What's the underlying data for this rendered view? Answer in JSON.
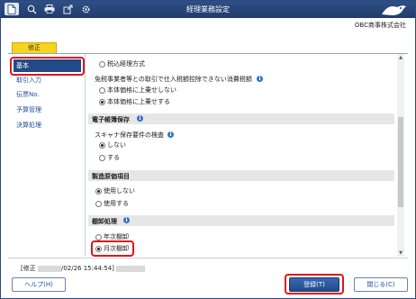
{
  "window": {
    "title": "経理業務設定",
    "company": "OBC商事株式会社"
  },
  "toolbar": {
    "icons": [
      "document-icon",
      "search-icon",
      "print-icon",
      "export-icon",
      "settings-icon"
    ]
  },
  "mode_badge": "修正",
  "sidebar": {
    "items": [
      {
        "label": "基本",
        "selected": true
      },
      {
        "label": "取引入力"
      },
      {
        "label": "伝票No."
      },
      {
        "label": "予算管理"
      },
      {
        "label": "決算処理"
      }
    ]
  },
  "content": {
    "top_option": "税込経理方式",
    "tax_question": "免税事業者等との取引で仕入税額控除できない消費税額",
    "tax_options": [
      "本体価格に上乗せしない",
      "本体価格に上乗せする"
    ],
    "tax_selected": 1,
    "section_denshi": "電子帳簿保存",
    "scanner_question": "スキャナ保存要件の検査",
    "scanner_options": [
      "しない",
      "する"
    ],
    "scanner_selected": 0,
    "section_cost": "製造原価項目",
    "cost_options": [
      "使用しない",
      "使用する"
    ],
    "cost_selected": 0,
    "section_inventory": "棚卸処理",
    "inventory_options": [
      "年次棚卸",
      "月次棚卸"
    ],
    "inventory_selected": 1
  },
  "status": {
    "prefix": "[修正",
    "datetime": "/02/26 15:44:54]"
  },
  "buttons": {
    "help": "ヘルプ(H)",
    "register": "登録(T)",
    "close": "閉じる(C)"
  }
}
